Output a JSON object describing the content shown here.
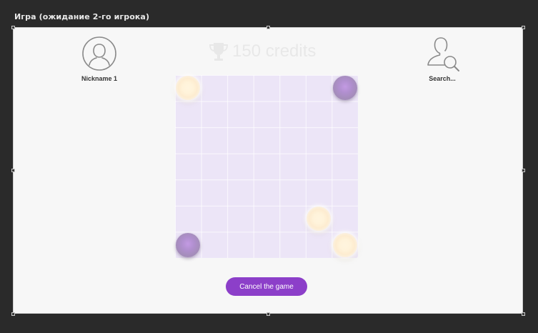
{
  "window": {
    "title": "Игра (ожидание 2-го игрока)"
  },
  "players": {
    "player1": {
      "name": "Nickname 1",
      "icon": "user-avatar-icon"
    },
    "player2": {
      "name": "Search...",
      "icon": "user-search-icon"
    }
  },
  "prize": {
    "icon": "trophy-icon",
    "text": "150 credits"
  },
  "board": {
    "size": 7,
    "pieces": [
      {
        "color": "light",
        "row": 0,
        "col": 0
      },
      {
        "color": "dark",
        "row": 0,
        "col": 6
      },
      {
        "color": "light",
        "row": 5,
        "col": 5
      },
      {
        "color": "dark",
        "row": 6,
        "col": 0
      },
      {
        "color": "light",
        "row": 6,
        "col": 6
      }
    ]
  },
  "actions": {
    "cancel_label": "Cancel the game"
  },
  "colors": {
    "accent": "#8c3fc9",
    "board": "#ece5f7",
    "light_piece": "#fff3da",
    "dark_piece": "#b08fce"
  }
}
